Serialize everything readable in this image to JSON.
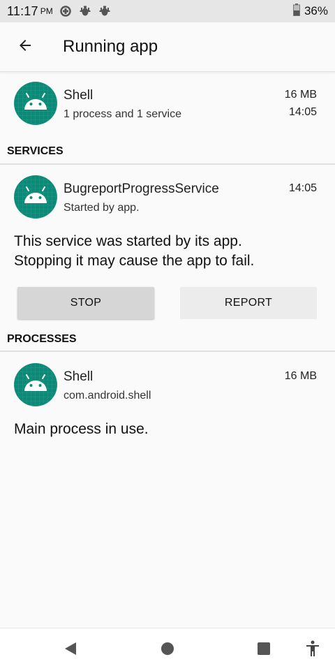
{
  "status_bar": {
    "time": "11:17",
    "ampm": "PM",
    "icons": [
      "data-saver-icon",
      "bug-icon",
      "bug-icon"
    ],
    "battery_percent": "36%"
  },
  "app_bar": {
    "title": "Running app"
  },
  "app_summary": {
    "name": "Shell",
    "subtitle": "1 process and 1 service",
    "memory": "16 MB",
    "time": "14:05"
  },
  "services": {
    "header": "SERVICES",
    "item": {
      "name": "BugreportProgressService",
      "subtitle": "Started by app.",
      "time": "14:05"
    },
    "description_line1": "This service was started by its app.",
    "description_line2": "Stopping it may cause the app to fail.",
    "stop_label": "STOP",
    "report_label": "REPORT"
  },
  "processes": {
    "header": "PROCESSES",
    "item": {
      "name": "Shell",
      "subtitle": "com.android.shell",
      "memory": "16 MB"
    },
    "description": "Main process in use."
  },
  "colors": {
    "icon_bg": "#0b8a78",
    "status_bar_bg": "#e6e6e6",
    "page_bg": "#fafafa"
  }
}
